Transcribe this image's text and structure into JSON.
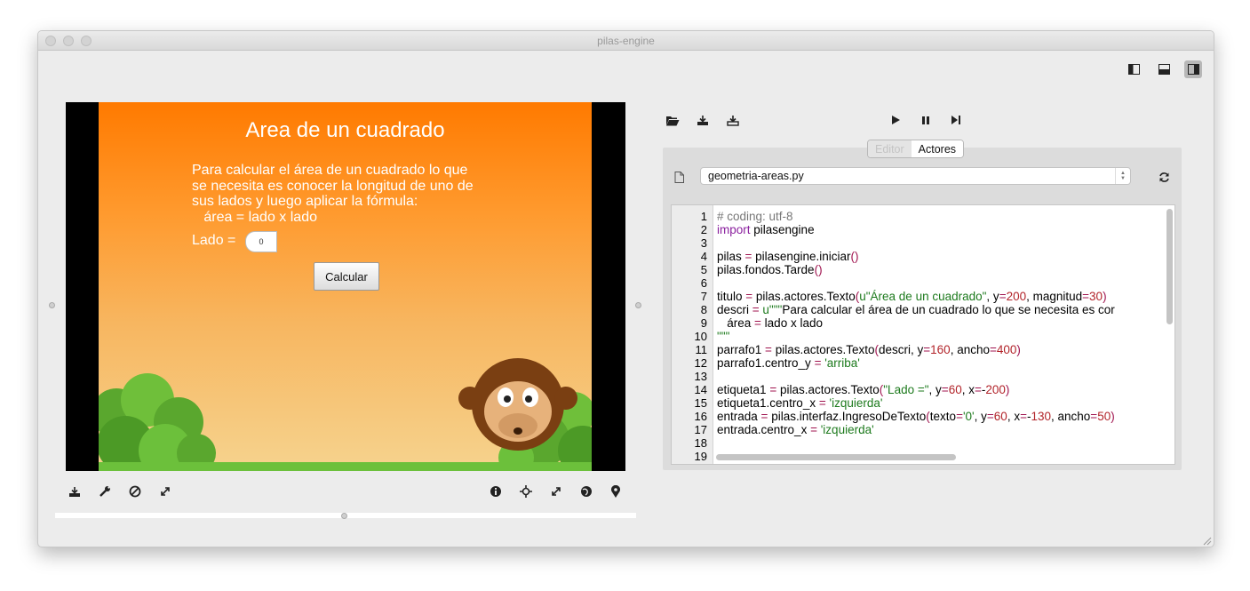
{
  "window": {
    "title": "pilas-engine"
  },
  "scene": {
    "title": "Area de un cuadrado",
    "description": "Para calcular el área de un cuadrado lo que\nse necesita es conocer la longitud de uno de\nsus lados y luego aplicar la fórmula:\n   área = lado x lado",
    "lado_label": "Lado =",
    "lado_value": "0",
    "button_label": "Calcular"
  },
  "tabs": [
    "Editor",
    "Actores"
  ],
  "file": {
    "name": "geometria-areas.py"
  },
  "editor": {
    "line_numbers": [
      "1",
      "2",
      "3",
      "4",
      "5",
      "6",
      "7",
      "8",
      "9",
      "10",
      "11",
      "12",
      "13",
      "14",
      "15",
      "16",
      "17",
      "18",
      "19"
    ],
    "lines": [
      "# coding: utf-8",
      "import pilasengine",
      "",
      "pilas = pilasengine.iniciar()",
      "pilas.fondos.Tarde()",
      "",
      "titulo = pilas.actores.Texto(u\"Área de un cuadrado\", y=200, magnitud=30)",
      "descri = u\"\"\"Para calcular el área de un cuadrado lo que se necesita es cor",
      "   área = lado x lado",
      "\"\"\"",
      "parrafo1 = pilas.actores.Texto(descri, y=160, ancho=400)",
      "parrafo1.centro_y = 'arriba'",
      "",
      "etiqueta1 = pilas.actores.Texto(\"Lado =\", y=60, x=-200)",
      "etiqueta1.centro_x = 'izquierda'",
      "entrada = pilas.interfaz.IngresoDeTexto(texto='0', y=60, x=-130, ancho=50)",
      "entrada.centro_x = 'izquierda'",
      "",
      ""
    ]
  },
  "icons": {
    "layout": [
      "layout-left-panel-icon",
      "layout-bottom-panel-icon",
      "layout-right-panel-icon"
    ],
    "toolbar": [
      "open-folder-icon",
      "save-icon",
      "save-as-icon",
      "play-icon",
      "pause-icon",
      "step-forward-icon"
    ],
    "canvas_tools": [
      "save-icon",
      "wrench-icon",
      "disable-icon",
      "expand-icon",
      "info-icon",
      "crosshair-icon",
      "fullscreen-icon",
      "globe-icon",
      "location-pin-icon"
    ]
  },
  "colors": {
    "scene_top": "#ff7a00",
    "scene_bottom": "#f6d38e",
    "keyword": "#8a1f9e",
    "operator": "#a0144f",
    "number": "#b2242a",
    "string": "#1d7a1d",
    "comment": "#777777"
  }
}
